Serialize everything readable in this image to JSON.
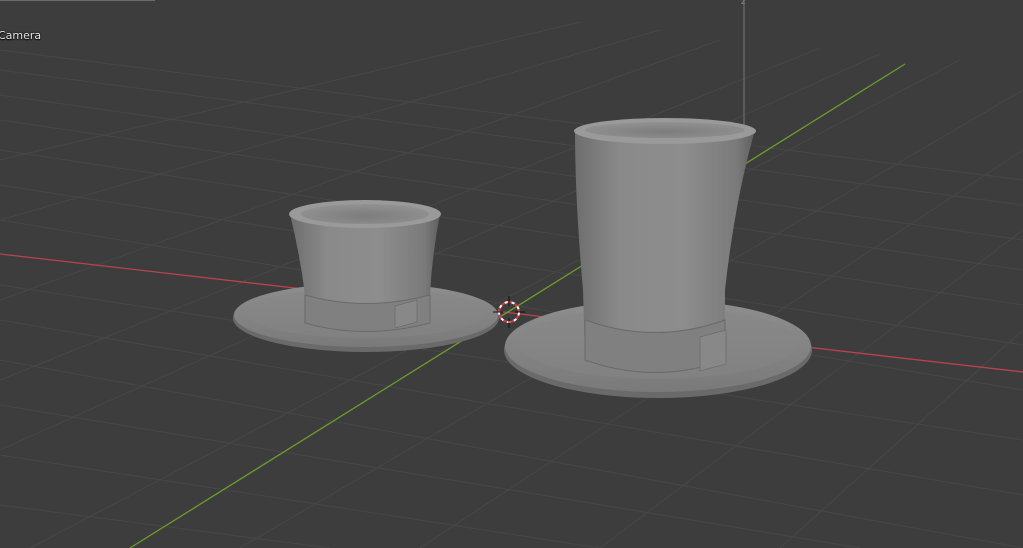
{
  "viewport": {
    "view_name": "",
    "object_name": "Camera",
    "axis_colors": {
      "x": "#b8444b",
      "y": "#6d9a2e",
      "z": "#8a8a8a",
      "grid": "#4a4a4a",
      "background": "#3d3d3d"
    }
  },
  "objects": [
    {
      "name": "top-hat-small",
      "color": "#8f8f8f"
    },
    {
      "name": "top-hat-tall",
      "color": "#8f8f8f"
    }
  ],
  "gizmo": {
    "icon": "3d-cursor-icon"
  }
}
